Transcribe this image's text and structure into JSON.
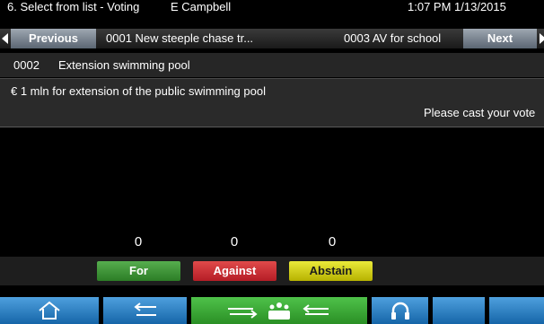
{
  "status": {
    "title": "6. Select from list - Voting",
    "user": "E Campbell",
    "datetime": "1:07 PM 1/13/2015"
  },
  "nav": {
    "previous_label": "Previous",
    "previous_item": "0001 New steeple chase tr...",
    "next_item": "0003 AV for school",
    "next_label": "Next"
  },
  "agenda": {
    "number": "0002",
    "title": "Extension swimming pool"
  },
  "description": {
    "text": "€ 1 mln for extension of the public swimming pool",
    "instruction": "Please cast your vote"
  },
  "results": {
    "for": "0",
    "against": "0",
    "abstain": "0"
  },
  "vote_options": {
    "for": "For",
    "against": "Against",
    "abstain": "Abstain"
  },
  "colors": {
    "for": "#3c9a35",
    "against": "#d42d34",
    "abstain": "#d8d41c",
    "button_blue": "#2d7fc1",
    "button_green": "#3aa834"
  },
  "bottom_bar": [
    {
      "icon": "home-icon"
    },
    {
      "icon": "back-icon"
    },
    {
      "icon": "microphone-request-icon"
    },
    {
      "icon": "headphones-icon"
    },
    {
      "icon": "blank"
    },
    {
      "icon": "blank"
    }
  ]
}
